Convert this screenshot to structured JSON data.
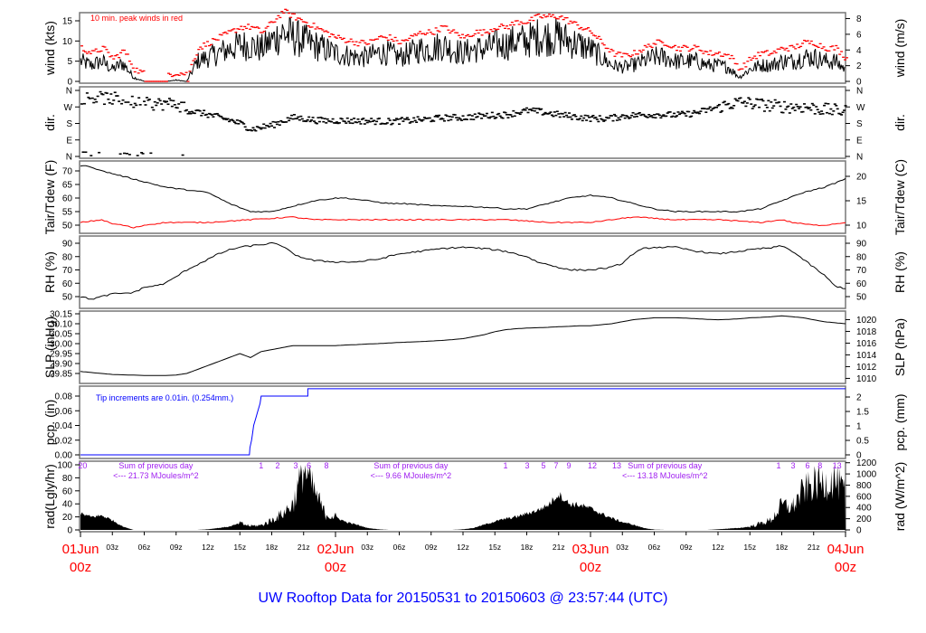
{
  "title": "UW Rooftop Data for 20150531  to  20150603 @ 23:57:44  (UTC)",
  "colors": {
    "peak": "#ff0000",
    "dewpoint": "#ff0000",
    "precip": "#0000ff",
    "annot": "#a020f0",
    "title": "#0000ff"
  },
  "chart_data": {
    "type": "line",
    "x_unit": "hours since 01Jun 00z",
    "xlim": [
      0,
      72
    ],
    "x_ticks": [
      {
        "h": 3,
        "label": "03z"
      },
      {
        "h": 6,
        "label": "06z"
      },
      {
        "h": 9,
        "label": "09z"
      },
      {
        "h": 12,
        "label": "12z"
      },
      {
        "h": 15,
        "label": "15z"
      },
      {
        "h": 18,
        "label": "18z"
      },
      {
        "h": 21,
        "label": "21z"
      },
      {
        "h": 27,
        "label": "03z"
      },
      {
        "h": 30,
        "label": "06z"
      },
      {
        "h": 33,
        "label": "09z"
      },
      {
        "h": 36,
        "label": "12z"
      },
      {
        "h": 39,
        "label": "15z"
      },
      {
        "h": 42,
        "label": "18z"
      },
      {
        "h": 45,
        "label": "21z"
      },
      {
        "h": 51,
        "label": "03z"
      },
      {
        "h": 54,
        "label": "06z"
      },
      {
        "h": 57,
        "label": "09z"
      },
      {
        "h": 60,
        "label": "12z"
      },
      {
        "h": 63,
        "label": "15z"
      },
      {
        "h": 66,
        "label": "18z"
      },
      {
        "h": 69,
        "label": "21z"
      }
    ],
    "date_ticks": [
      {
        "h": 0,
        "date": "01Jun",
        "time": "00z"
      },
      {
        "h": 24,
        "date": "02Jun",
        "time": "00z"
      },
      {
        "h": 48,
        "date": "03Jun",
        "time": "00z"
      },
      {
        "h": 72,
        "date": "04Jun",
        "time": "00z"
      }
    ],
    "panels": [
      {
        "id": "wind",
        "ylabel": "wind (kts)",
        "ylabel_right": "wind (m/s)",
        "ylim": [
          0,
          15
        ],
        "ticks": [
          0,
          5,
          10,
          15
        ],
        "ticks_right": [
          0,
          2,
          4,
          6,
          8
        ],
        "annotation": "10 min. peak winds in red",
        "series": [
          {
            "name": "wind speed",
            "values": [
              5,
              4,
              5,
              3,
              4.5,
              1,
              0,
              0,
              0,
              0.3,
              0,
              5,
              6,
              7,
              8,
              9,
              9,
              8,
              10,
              12,
              11,
              10,
              9,
              8,
              7,
              6.5,
              6,
              6,
              7,
              7,
              6,
              7,
              8,
              8,
              9,
              8,
              7,
              8,
              8,
              9,
              9,
              10,
              10,
              11,
              11,
              11,
              10,
              9,
              8,
              6,
              4,
              3.5,
              4,
              5,
              6,
              6,
              5,
              5,
              5,
              4,
              4,
              3.5,
              1,
              3,
              4,
              4,
              5,
              5,
              6,
              6,
              5,
              5,
              3
            ]
          }
        ]
      },
      {
        "id": "dir",
        "ylabel": "dir.",
        "ylabel_right": "dir.",
        "ylim": [
          0,
          360
        ],
        "tick_labels": [
          {
            "v": 0,
            "t": "N"
          },
          {
            "v": 90,
            "t": "E"
          },
          {
            "v": 180,
            "t": "S"
          },
          {
            "v": 270,
            "t": "W"
          },
          {
            "v": 360,
            "t": "N"
          }
        ],
        "series": [
          {
            "name": "wind direction (deg)",
            "values": [
              320,
              320,
              318,
              315,
              310,
              290,
              286,
              286,
              288,
              286,
              250,
              240,
              227,
              212,
              197,
              178,
              148,
              160,
              172,
              195,
              212,
              205,
              197,
              195,
              196,
              195,
              194,
              193,
              192,
              190,
              194,
              196,
              200,
              205,
              210,
              212,
              212,
              218,
              222,
              225,
              227,
              240,
              250,
              245,
              235,
              227,
              220,
              212,
              208,
              205,
              210,
              220,
              225,
              227,
              228,
              227,
              226,
              230,
              240,
              255,
              271,
              285,
              296,
              290,
              282,
              276,
              272,
              270,
              270,
              262,
              255,
              250,
              245
            ]
          }
        ]
      },
      {
        "id": "temp",
        "ylabel": "Tair/Tdew (F)",
        "ylabel_right": "Tair/Tdew (C)",
        "ylim": [
          50,
          70
        ],
        "ticks": [
          50,
          55,
          60,
          65,
          70
        ],
        "ticks_right": [
          10,
          15,
          20
        ],
        "series": [
          {
            "name": "Tair",
            "values": [
              72,
              71.5,
              70,
              69,
              68,
              67,
              66,
              65,
              64,
              63.5,
              63,
              62.5,
              62,
              60,
              58,
              56.5,
              55,
              55,
              55,
              56,
              57,
              58,
              59,
              59.5,
              60,
              60,
              59.5,
              59,
              58.5,
              58,
              58,
              57.8,
              57.5,
              57.3,
              57,
              57,
              57,
              56.8,
              56.6,
              56.4,
              56,
              56,
              56,
              57,
              58,
              59,
              60,
              60.5,
              61,
              60.5,
              60,
              59,
              58,
              57,
              56,
              55.5,
              55,
              55,
              55,
              55,
              55,
              55,
              55,
              55.5,
              56,
              57.5,
              59,
              60.5,
              62,
              63,
              64,
              65.5,
              67
            ]
          },
          {
            "name": "Tdew",
            "values": [
              51,
              51.5,
              52,
              50.5,
              50,
              49,
              50,
              50.5,
              51,
              51,
              51,
              51,
              51,
              51.3,
              51.5,
              51.8,
              52,
              52.3,
              52.5,
              52.8,
              53,
              52.5,
              52,
              52,
              52,
              52,
              52,
              52,
              52,
              52,
              52,
              52,
              52,
              52,
              52,
              52,
              52,
              52,
              52,
              52,
              52,
              51.8,
              51.5,
              51.3,
              51,
              51,
              51,
              51,
              51,
              51.5,
              52,
              52.5,
              53,
              52.8,
              52.5,
              52.2,
              52,
              52,
              52,
              52,
              52,
              51.8,
              51.5,
              51.2,
              51,
              51.5,
              52,
              51,
              50.5,
              50,
              50,
              50.5,
              51
            ]
          }
        ]
      },
      {
        "id": "rh",
        "ylabel": "RH (%)",
        "ylabel_right": "RH (%)",
        "ylim": [
          50,
          90
        ],
        "ticks": [
          50,
          60,
          70,
          80,
          90
        ],
        "ticks_right": [
          50,
          60,
          70,
          80,
          90
        ],
        "series": [
          {
            "name": "RH",
            "values": [
              50,
              48,
              50,
              52,
              52.5,
              53,
              57,
              58,
              60,
              65,
              70,
              74,
              78,
              82,
              85,
              87,
              88,
              89,
              90,
              88,
              82,
              79,
              77,
              76.5,
              76,
              76,
              76,
              77,
              78,
              80,
              82,
              83,
              84,
              85,
              86,
              86.5,
              87,
              86.5,
              86,
              85,
              84,
              82,
              80,
              76,
              74,
              72,
              70,
              70,
              70,
              71,
              72,
              75,
              82,
              86,
              87,
              87,
              87,
              85.5,
              84,
              83,
              82,
              83,
              84,
              85,
              86,
              86.5,
              88,
              84,
              78,
              72,
              66,
              58,
              56
            ]
          }
        ]
      },
      {
        "id": "slp",
        "ylabel": "SLP (inHg)",
        "ylabel_right": "SLP (hPa)",
        "ylim": [
          29.85,
          30.15
        ],
        "ticks": [
          29.85,
          29.9,
          29.95,
          30.0,
          30.05,
          30.1,
          30.15
        ],
        "ticks_right": [
          1010,
          1012,
          1014,
          1016,
          1018,
          1020
        ],
        "series": [
          {
            "name": "SLP",
            "values": [
              29.86,
              29.855,
              29.85,
              29.845,
              29.843,
              29.842,
              29.84,
              29.84,
              29.84,
              29.842,
              29.85,
              29.87,
              29.89,
              29.91,
              29.93,
              29.95,
              29.93,
              29.96,
              29.97,
              29.98,
              29.99,
              29.99,
              29.99,
              29.99,
              29.99,
              29.993,
              29.995,
              29.998,
              30.0,
              30.003,
              30.006,
              30.008,
              30.01,
              30.013,
              30.016,
              30.02,
              30.025,
              30.035,
              30.045,
              30.06,
              30.07,
              30.075,
              30.078,
              30.08,
              30.082,
              30.085,
              30.087,
              30.09,
              30.09,
              30.095,
              30.1,
              30.11,
              30.12,
              30.125,
              30.13,
              30.13,
              30.13,
              30.128,
              30.125,
              30.122,
              30.12,
              30.122,
              30.125,
              30.13,
              30.132,
              30.135,
              30.14,
              30.135,
              30.13,
              30.12,
              30.11,
              30.105,
              30.1
            ]
          }
        ]
      },
      {
        "id": "pcp",
        "ylabel": "pcp. (in)",
        "ylabel_right": "pcp. (mm)",
        "ylim": [
          0,
          0.08
        ],
        "ticks": [
          0,
          0.02,
          0.04,
          0.06,
          0.08
        ],
        "ticks_right": [
          0,
          0.5,
          1,
          1.5,
          2
        ],
        "annotation": "Tip increments are 0.01in. (0.254mm.)",
        "steps": [
          [
            0,
            0
          ],
          [
            15.9,
            0
          ],
          [
            15.95,
            0.01
          ],
          [
            16.1,
            0.02
          ],
          [
            16.2,
            0.03
          ],
          [
            16.3,
            0.04
          ],
          [
            16.5,
            0.05
          ],
          [
            16.7,
            0.06
          ],
          [
            16.9,
            0.07
          ],
          [
            17.0,
            0.08
          ],
          [
            21.4,
            0.08
          ],
          [
            21.4,
            0.09
          ],
          [
            72,
            0.09
          ]
        ]
      },
      {
        "id": "rad",
        "ylabel": "rad(Lgly/hr)",
        "ylabel_right": "rad (W/m^2)",
        "ylim": [
          0,
          100
        ],
        "ticks": [
          0,
          20,
          40,
          60,
          80,
          100
        ],
        "ticks_right": [
          0,
          200,
          400,
          600,
          800,
          1000,
          1200
        ],
        "series": [
          {
            "name": "solar radiation",
            "values": [
              25,
              20,
              22,
              15,
              5,
              0,
              0,
              0,
              0,
              0,
              0,
              0,
              1,
              3,
              5,
              10,
              6,
              7,
              15,
              25,
              40,
              95,
              60,
              25,
              20,
              12,
              8,
              3,
              1,
              0,
              0,
              0,
              0,
              0,
              0,
              0,
              1,
              3,
              8,
              13,
              17,
              20,
              25,
              30,
              38,
              55,
              40,
              38,
              33,
              25,
              18,
              12,
              8,
              3,
              0.5,
              0,
              0,
              0,
              0,
              0,
              1,
              2,
              3,
              5,
              10,
              15,
              38,
              35,
              60,
              70,
              72,
              78,
              55
            ]
          }
        ],
        "hour_marks": [
          {
            "h": 0.2,
            "t": "20"
          },
          {
            "h": 17.0,
            "t": "1"
          },
          {
            "h": 18.55,
            "t": "2"
          },
          {
            "h": 20.26,
            "t": "3"
          },
          {
            "h": 21.5,
            "t": "6"
          },
          {
            "h": 23.15,
            "t": "8"
          },
          {
            "h": 40.0,
            "t": "1"
          },
          {
            "h": 42.04,
            "t": "3"
          },
          {
            "h": 43.57,
            "t": "5"
          },
          {
            "h": 44.77,
            "t": "7"
          },
          {
            "h": 45.96,
            "t": "9"
          },
          {
            "h": 48.17,
            "t": "12"
          },
          {
            "h": 50.47,
            "t": "13"
          },
          {
            "h": 65.7,
            "t": "1"
          },
          {
            "h": 67.06,
            "t": "3"
          },
          {
            "h": 68.43,
            "t": "6"
          },
          {
            "h": 69.6,
            "t": "8"
          },
          {
            "h": 71.2,
            "t": "13"
          }
        ],
        "daily_sums": [
          {
            "h": 7.1,
            "label": "Sum of previous day",
            "value": "<--- 21.73 MJoules/m^2"
          },
          {
            "h": 31.1,
            "label": "Sum of previous day",
            "value": "<--- 9.66 MJoules/m^2"
          },
          {
            "h": 55.0,
            "label": "Sum of previous day",
            "value": "<--- 13.18 MJoules/m^2"
          }
        ]
      }
    ]
  }
}
